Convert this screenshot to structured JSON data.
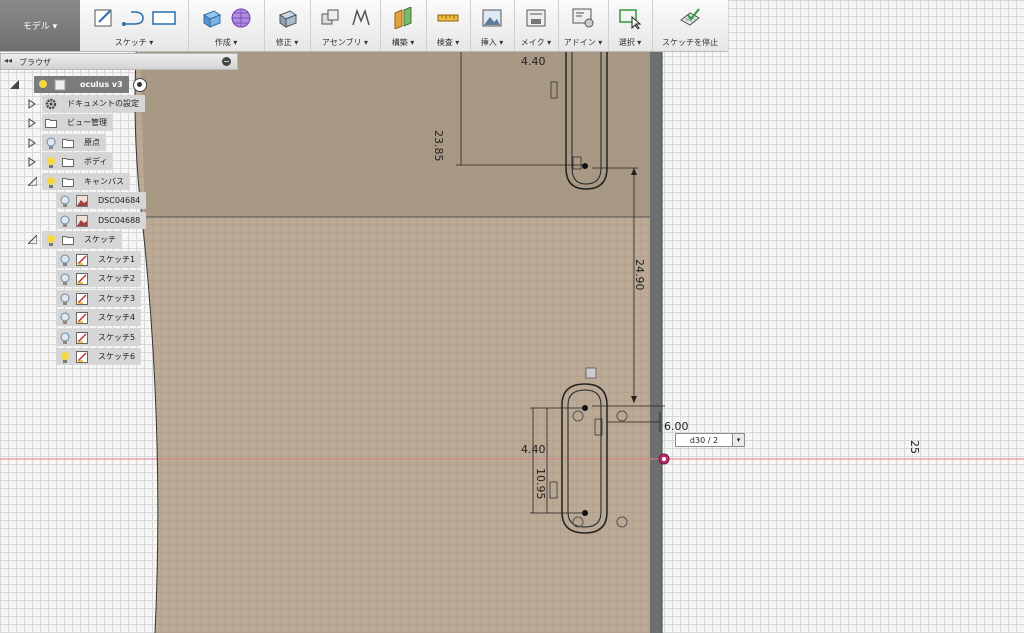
{
  "toolbar": {
    "workspace": "モデル ▾",
    "groups": [
      {
        "label": "スケッチ ▾"
      },
      {
        "label": "作成 ▾"
      },
      {
        "label": "修正 ▾"
      },
      {
        "label": "アセンブリ ▾"
      },
      {
        "label": "構築 ▾"
      },
      {
        "label": "検査 ▾"
      },
      {
        "label": "挿入 ▾"
      },
      {
        "label": "メイク ▾"
      },
      {
        "label": "アドイン ▾"
      },
      {
        "label": "選択 ▾"
      },
      {
        "label": "スケッチを停止"
      }
    ]
  },
  "browser": {
    "title": "ブラウザ",
    "collapse": "◂◂",
    "root": "oculus v3",
    "items": [
      {
        "label": "ドキュメントの設定"
      },
      {
        "label": "ビュー管理"
      },
      {
        "label": "原点"
      },
      {
        "label": "ボディ"
      },
      {
        "label": "キャンバス"
      },
      {
        "label": "DSC04684"
      },
      {
        "label": "DSC04688"
      },
      {
        "label": "スケッチ"
      },
      {
        "label": "スケッチ1"
      },
      {
        "label": "スケッチ2"
      },
      {
        "label": "スケッチ3"
      },
      {
        "label": "スケッチ4"
      },
      {
        "label": "スケッチ5"
      },
      {
        "label": "スケッチ6"
      }
    ]
  },
  "dimensions": {
    "d_top_width": "4.40",
    "d_top_height": "23.85",
    "d_mid": "24.90",
    "d_bottom_width": "4.40",
    "d_bottom_height": "10.95",
    "d_small": "6.00",
    "d_edge": "25"
  },
  "dim_input": {
    "value": "d30 / 2",
    "dropdown": "▾"
  },
  "colors": {
    "canvas_image": "#b3a08a",
    "grid": "#d8d8d8",
    "toolbar": "#e9e9e9",
    "tree_node": "#d6d6d6",
    "axis_red": "#e08080"
  }
}
